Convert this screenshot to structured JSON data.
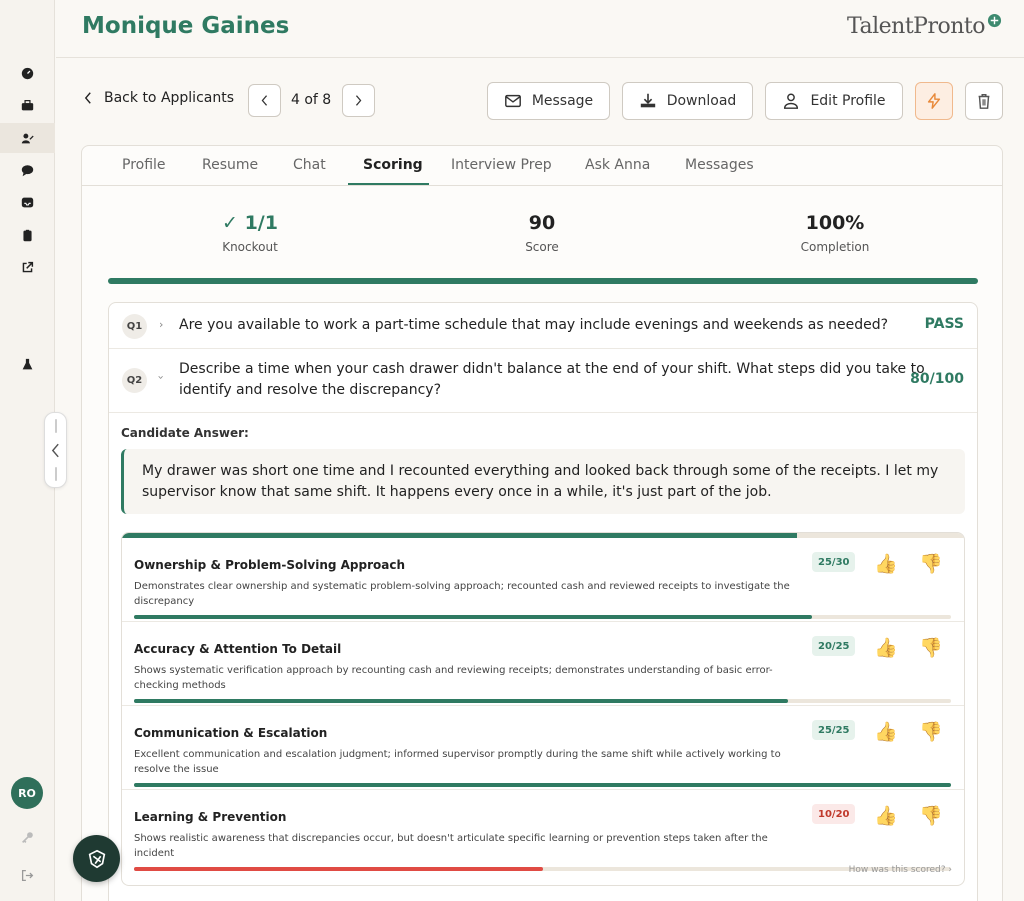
{
  "app": {
    "logo_text": "TalentPronto"
  },
  "header": {
    "title": "Monique Gaines"
  },
  "rail": {
    "avatar_initials": "RO"
  },
  "toolbar": {
    "back_label": "Back to Applicants",
    "pager_text": "4 of 8",
    "message_label": "Message",
    "download_label": "Download",
    "edit_profile_label": "Edit Profile"
  },
  "tabs": [
    "Profile",
    "Resume",
    "Chat",
    "Scoring",
    "Interview Prep",
    "Ask Anna",
    "Messages"
  ],
  "active_tab": "Scoring",
  "stats": {
    "knockout": {
      "value": "✓ 1/1",
      "label": "Knockout"
    },
    "score": {
      "value": "90",
      "label": "Score"
    },
    "completion": {
      "value": "100%",
      "label": "Completion"
    }
  },
  "questions": [
    {
      "num": "Q1",
      "text": "Are you available to work a part-time schedule that may include evenings and weekends as needed?",
      "result": "PASS",
      "expanded": false
    },
    {
      "num": "Q2",
      "text_line1": "Describe a time when your cash drawer didn't balance at the end of your shift. What steps did you take to",
      "text_line2": "identify and resolve the discrepancy?",
      "result": "80/100",
      "expanded": true
    }
  ],
  "answer": {
    "label": "Candidate Answer:",
    "line1": "My drawer was short one time and I recounted everything and looked back through some of the receipts. I let my",
    "line2": "supervisor know that same shift. It happens every once in a while, it's just part of the job."
  },
  "overall_fill_pct": 80,
  "criteria": [
    {
      "name": "Ownership & Problem-Solving Approach",
      "desc_line1": "Demonstrates clear ownership and systematic problem-solving approach; recounted cash and reviewed receipts to investigate the",
      "desc_line2": "discrepancy",
      "score": "25/30",
      "fill_pct": 83,
      "status": "good"
    },
    {
      "name": "Accuracy & Attention To Detail",
      "desc_line1": "Shows systematic verification approach by recounting cash and reviewing receipts; demonstrates understanding of basic error-",
      "desc_line2": "checking methods",
      "score": "20/25",
      "fill_pct": 80,
      "status": "good"
    },
    {
      "name": "Communication & Escalation",
      "desc_line1": "Excellent communication and escalation judgment; informed supervisor promptly during the same shift while actively working to",
      "desc_line2": "resolve the issue",
      "score": "25/25",
      "fill_pct": 100,
      "status": "good"
    },
    {
      "name": "Learning & Prevention",
      "desc_line1": "Shows realistic awareness that discrepancies occur, but doesn't articulate specific learning or prevention steps taken after the incident",
      "desc_line2": "",
      "score": "10/20",
      "fill_pct": 50,
      "status": "bad"
    }
  ],
  "how_scored": "How was this scored?  ›",
  "colors": {
    "brand": "#2f7a62",
    "danger": "#e04b44",
    "warning_accent": "#e8893a"
  }
}
